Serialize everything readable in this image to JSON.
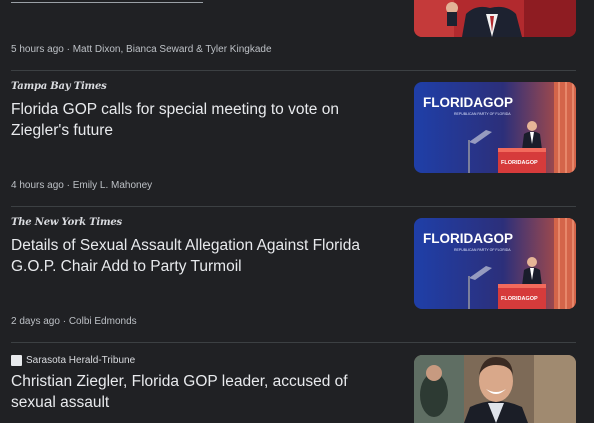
{
  "articles": [
    {
      "headline_partial": "",
      "meta": "5 hours ago · Matt Dixon, Bianca Seward & Tyler Kingkade",
      "thumbnail": "man-speaking-photo"
    },
    {
      "source": "Tampa Bay Times",
      "headline": "Florida GOP calls for special meeting to vote on Ziegler's future",
      "meta": "4 hours ago · Emily L. Mahoney",
      "thumbnail": "florida-gop-podium-photo",
      "thumb_banner": "FLORIDAGOP",
      "thumb_sub": "REPUBLICAN PARTY OF FLORIDA",
      "thumb_podium": "FLORIDAGOP"
    },
    {
      "source": "The New York Times",
      "headline": "Details of Sexual Assault Allegation Against Florida G.O.P. Chair Add to Party Turmoil",
      "meta": "2 days ago · Colbi Edmonds",
      "thumbnail": "florida-gop-podium-photo",
      "thumb_banner": "FLORIDAGOP",
      "thumb_sub": "REPUBLICAN PARTY OF FLORIDA",
      "thumb_podium": "FLORIDAGOP"
    },
    {
      "source": "Sarasota Herald-Tribune",
      "headline": "Christian Ziegler, Florida GOP leader, accused of sexual assault",
      "thumbnail": "man-portrait-photo"
    }
  ]
}
